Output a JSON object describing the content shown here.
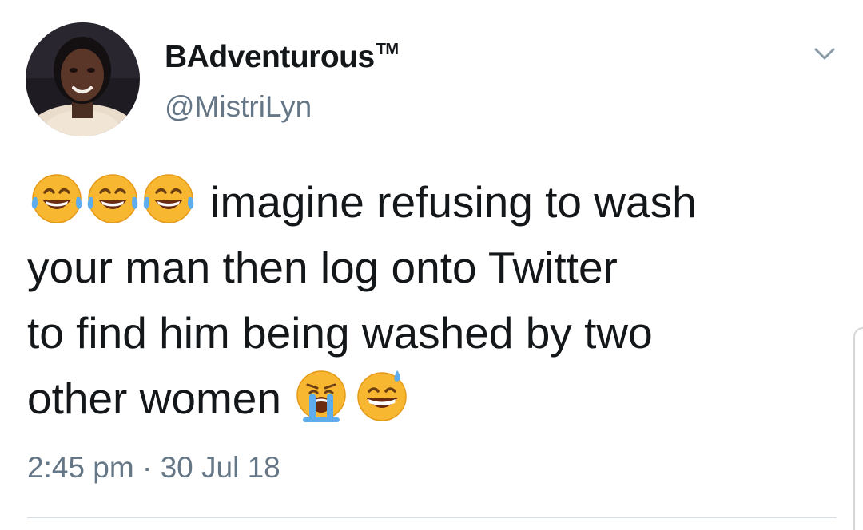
{
  "tweet": {
    "display_name": "BAdventurous",
    "trademark": "TM",
    "handle": "@MistriLyn",
    "text_lines": [
      "imagine refusing to wash",
      "your man then log onto Twitter",
      "to find him being washed by two",
      "other women"
    ],
    "leading_emojis": [
      "face-with-tears-of-joy",
      "face-with-tears-of-joy",
      "face-with-tears-of-joy"
    ],
    "trailing_emojis": [
      "loudly-crying-face",
      "grinning-face-with-sweat"
    ],
    "timestamp": "2:45 pm · 30 Jul 18"
  },
  "icons": {
    "menu": "chevron-down-icon",
    "avatar": "user-avatar"
  },
  "colors": {
    "text": "#14171a",
    "secondary": "#657786",
    "divider": "#d8dfe4",
    "emoji_face": "#f7b731",
    "tears": "#5dadec"
  }
}
